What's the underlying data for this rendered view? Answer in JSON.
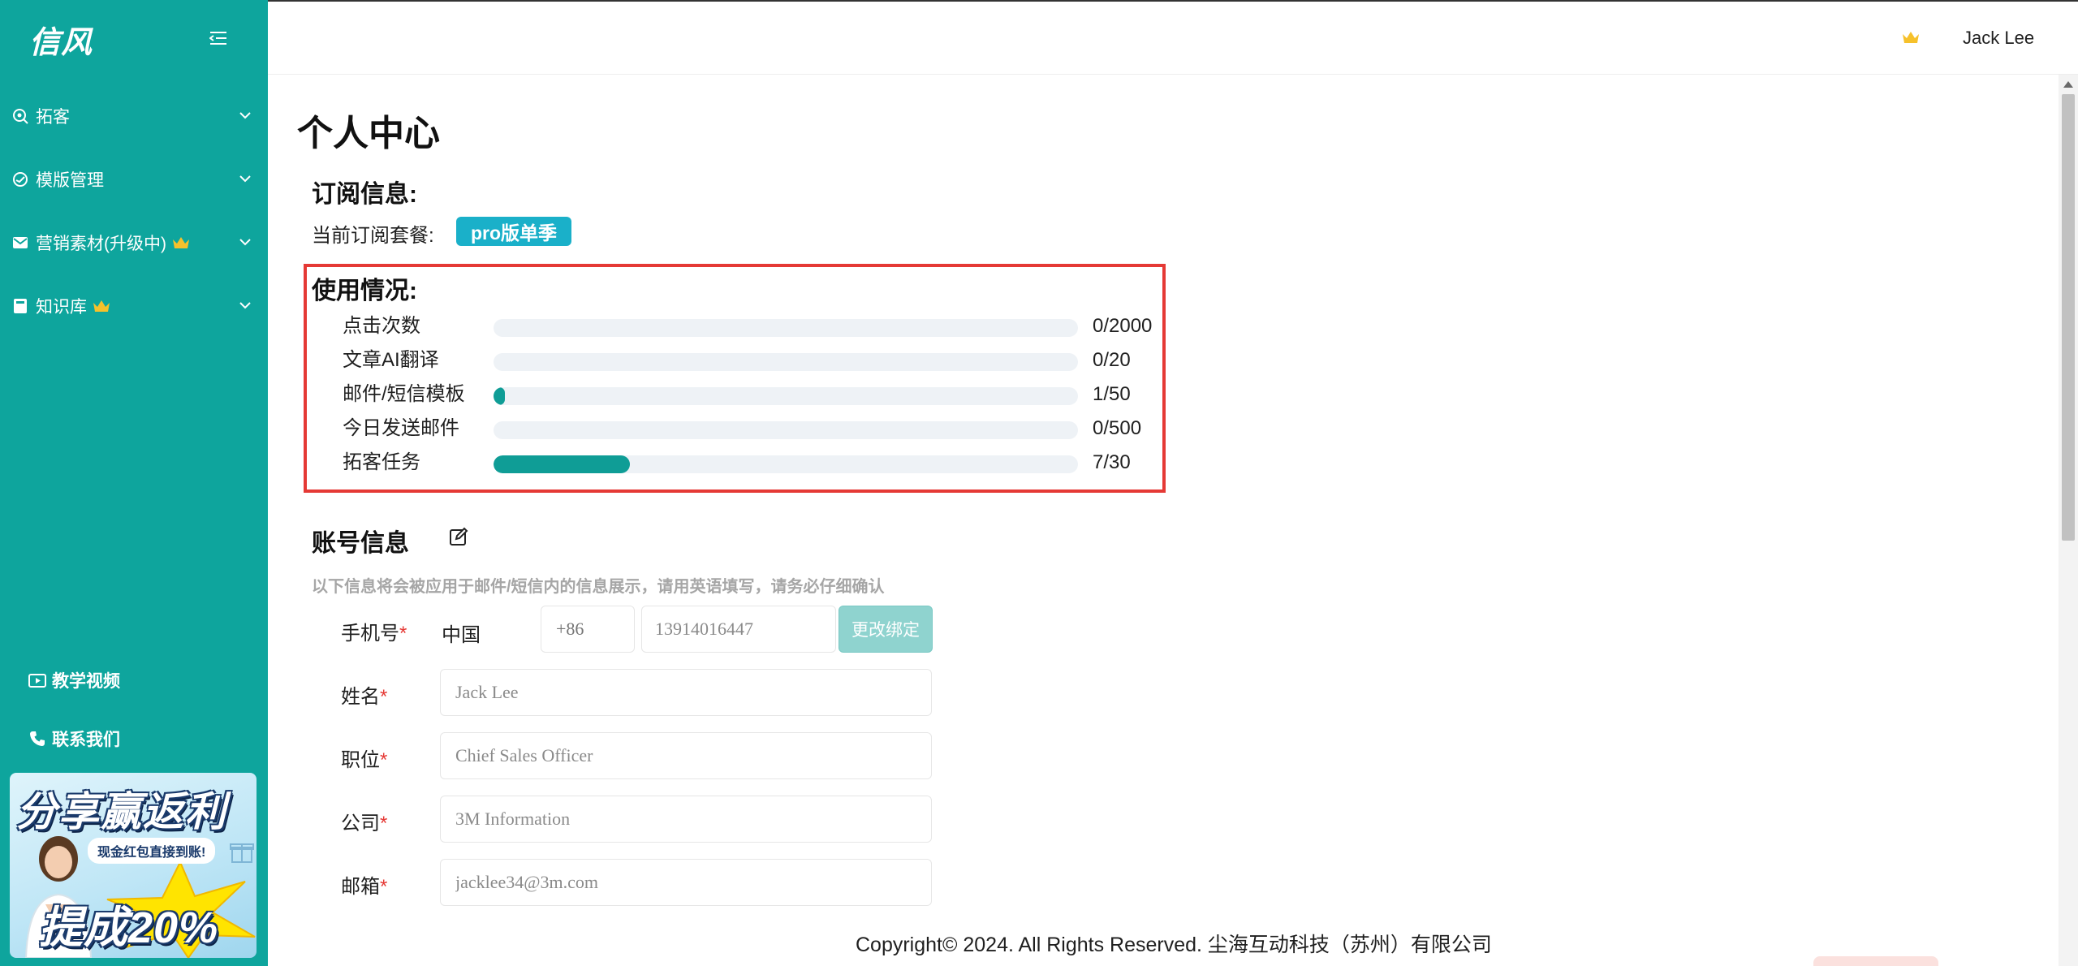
{
  "app": {
    "logo": "信风"
  },
  "sidebar": {
    "items": [
      {
        "label": "拓客",
        "icon": "search-target-icon",
        "vip": false
      },
      {
        "label": "模版管理",
        "icon": "template-gauge-icon",
        "vip": false
      },
      {
        "label": "营销素材(升级中)",
        "icon": "mail-icon",
        "vip": true
      },
      {
        "label": "知识库",
        "icon": "book-icon",
        "vip": true
      }
    ],
    "tutorial_label": "教学视频",
    "contact_label": "联系我们",
    "promo": {
      "title": "分享赢返利",
      "subtitle": "现金红包直接到账!",
      "commission": "提成20%"
    }
  },
  "header": {
    "user_name": "Jack Lee"
  },
  "page": {
    "title": "个人中心",
    "subscription": {
      "section_title": "订阅信息:",
      "plan_label": "当前订阅套餐:",
      "plan_name": "pro版单季"
    },
    "usage": {
      "section_title": "使用情况:",
      "rows": [
        {
          "label": "点击次数",
          "used": 0,
          "total": 2000,
          "display": "0/2000"
        },
        {
          "label": "文章AI翻译",
          "used": 0,
          "total": 20,
          "display": "0/20"
        },
        {
          "label": "邮件/短信模板",
          "used": 1,
          "total": 50,
          "display": "1/50"
        },
        {
          "label": "今日发送邮件",
          "used": 0,
          "total": 500,
          "display": "0/500"
        },
        {
          "label": "拓客任务",
          "used": 7,
          "total": 30,
          "display": "7/30"
        }
      ]
    },
    "account": {
      "section_title": "账号信息",
      "hint": "以下信息将会被应用于邮件/短信内的信息展示，请用英语填写，请务必仔细确认",
      "required_mark": "*",
      "phone": {
        "label": "手机号",
        "country": "中国",
        "country_code_placeholder": "+86",
        "number": "13914016447",
        "rebind_label": "更改绑定"
      },
      "name": {
        "label": "姓名",
        "value": "Jack Lee"
      },
      "position": {
        "label": "职位",
        "value": "Chief Sales Officer"
      },
      "company": {
        "label": "公司",
        "value": "3M Information"
      },
      "email": {
        "label": "邮箱",
        "value": "jacklee34@3m.com"
      }
    }
  },
  "footer": {
    "copyright": "Copyright© 2024. All Rights Reserved. 尘海互动科技（苏州）有限公司"
  },
  "colors": {
    "sidebar": "#0ea59d",
    "accent": "#0f9d96",
    "badge": "#1ab0c9",
    "highlight_border": "#e53935",
    "crown": "#f6c12b"
  }
}
